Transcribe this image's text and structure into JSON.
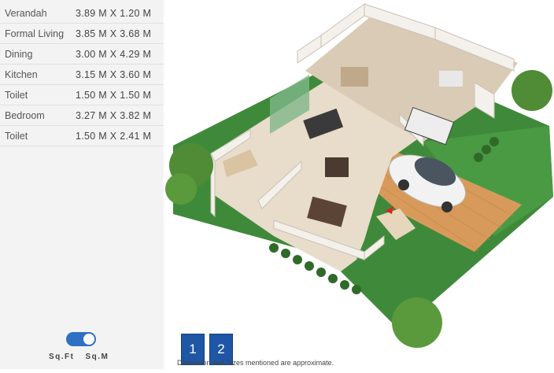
{
  "rooms": [
    {
      "name": "Verandah",
      "size": "3.89 M X 1.20 M"
    },
    {
      "name": "Formal Living",
      "size": "3.85 M X 3.68 M"
    },
    {
      "name": "Dining",
      "size": "3.00 M X 4.29 M"
    },
    {
      "name": "Kitchen",
      "size": "3.15 M X 3.60 M"
    },
    {
      "name": "Toilet",
      "size": "1.50 M X 1.50 M"
    },
    {
      "name": "Bedroom",
      "size": "3.27 M X 3.82 M"
    },
    {
      "name": "Toilet",
      "size": "1.50 M X 2.41 M"
    }
  ],
  "unit_toggle": {
    "left_label": "Sq.Ft",
    "right_label": "Sq.M",
    "selected": "Sq.M"
  },
  "floors": [
    "1",
    "2"
  ],
  "disclaimer": "Dimension and Sizes mentioned are approximate.",
  "colors": {
    "accent": "#1f56a6",
    "toggle": "#2f6fc4",
    "lawn": "#3f8a3a",
    "paving": "#d89a5a"
  }
}
